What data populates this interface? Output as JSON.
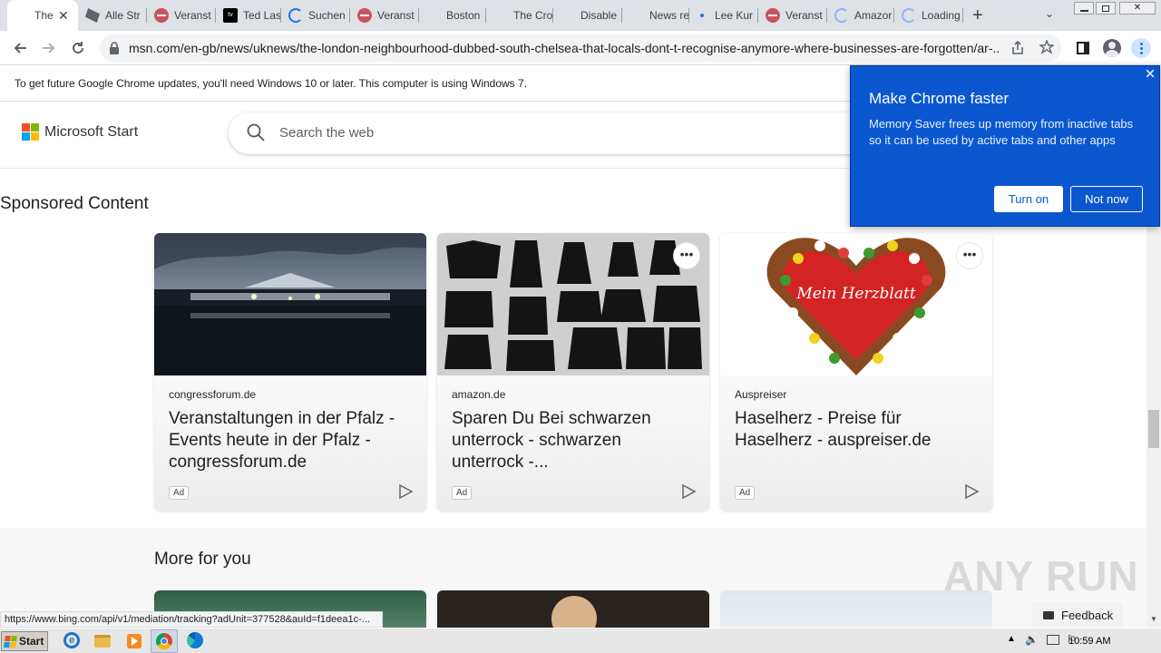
{
  "tabs": [
    {
      "title": "The",
      "favicon": "microsoft-icon",
      "active": true
    },
    {
      "title": "Alle Str",
      "favicon": "bag-icon"
    },
    {
      "title": "Veranst",
      "favicon": "red-circle-icon"
    },
    {
      "title": "Ted Las",
      "favicon": "appletv-icon"
    },
    {
      "title": "Suchen",
      "favicon": "loading-spinner-icon"
    },
    {
      "title": "Veranst",
      "favicon": "red-circle-icon"
    },
    {
      "title": "Boston",
      "favicon": "microsoft-icon"
    },
    {
      "title": "The Cro",
      "favicon": "microsoft-icon"
    },
    {
      "title": "Disable",
      "favicon": "microsoft-icon"
    },
    {
      "title": "News re",
      "favicon": "microsoft-icon"
    },
    {
      "title": "Lee Kur",
      "favicon": "dot-icon"
    },
    {
      "title": "Veranst",
      "favicon": "red-circle-icon"
    },
    {
      "title": "Amazor",
      "favicon": "loading-spinner-icon"
    },
    {
      "title": "Loading",
      "favicon": "loading-spinner-icon"
    }
  ],
  "appletv_label": "tv",
  "address": {
    "url": "msn.com/en-gb/news/uknews/the-london-neighbourhood-dubbed-south-chelsea-that-locals-dont-t-recognise-anymore-where-businesses-are-forgotten/ar-..."
  },
  "infobar": {
    "message": "To get future Google Chrome updates, you'll need Windows 10 or later. This computer is using Windows 7."
  },
  "header": {
    "brand": "Microsoft Start",
    "search_placeholder": "Search the web"
  },
  "sponsored": {
    "title": "Sponsored Content",
    "cards": [
      {
        "source": "congressforum.de",
        "headline": "Veranstaltungen in der Pfalz - Events heute in der Pfalz - congressforum.de",
        "badge": "Ad"
      },
      {
        "source": "amazon.de",
        "headline": "Sparen Du Bei schwarzen unterrock - schwarzen unterrock -...",
        "badge": "Ad"
      },
      {
        "source": "Auspreiser",
        "headline": "Haselherz - Preise für Haselherz - auspreiser.de",
        "badge": "Ad"
      }
    ],
    "heart_text": "Mein Herzblatt"
  },
  "more": {
    "title": "More for you"
  },
  "status_url": "https://www.bing.com/api/v1/mediation/tracking?adUnit=377528&auId=f1deea1c-...",
  "feedback": "Feedback",
  "watermark": "ANY RUN",
  "popup": {
    "title": "Make Chrome faster",
    "body": "Memory Saver frees up memory from inactive tabs so it can be used by active tabs and other apps",
    "turn_on": "Turn on",
    "not_now": "Not now"
  },
  "taskbar": {
    "start": "Start",
    "clock": "10:59 AM"
  }
}
